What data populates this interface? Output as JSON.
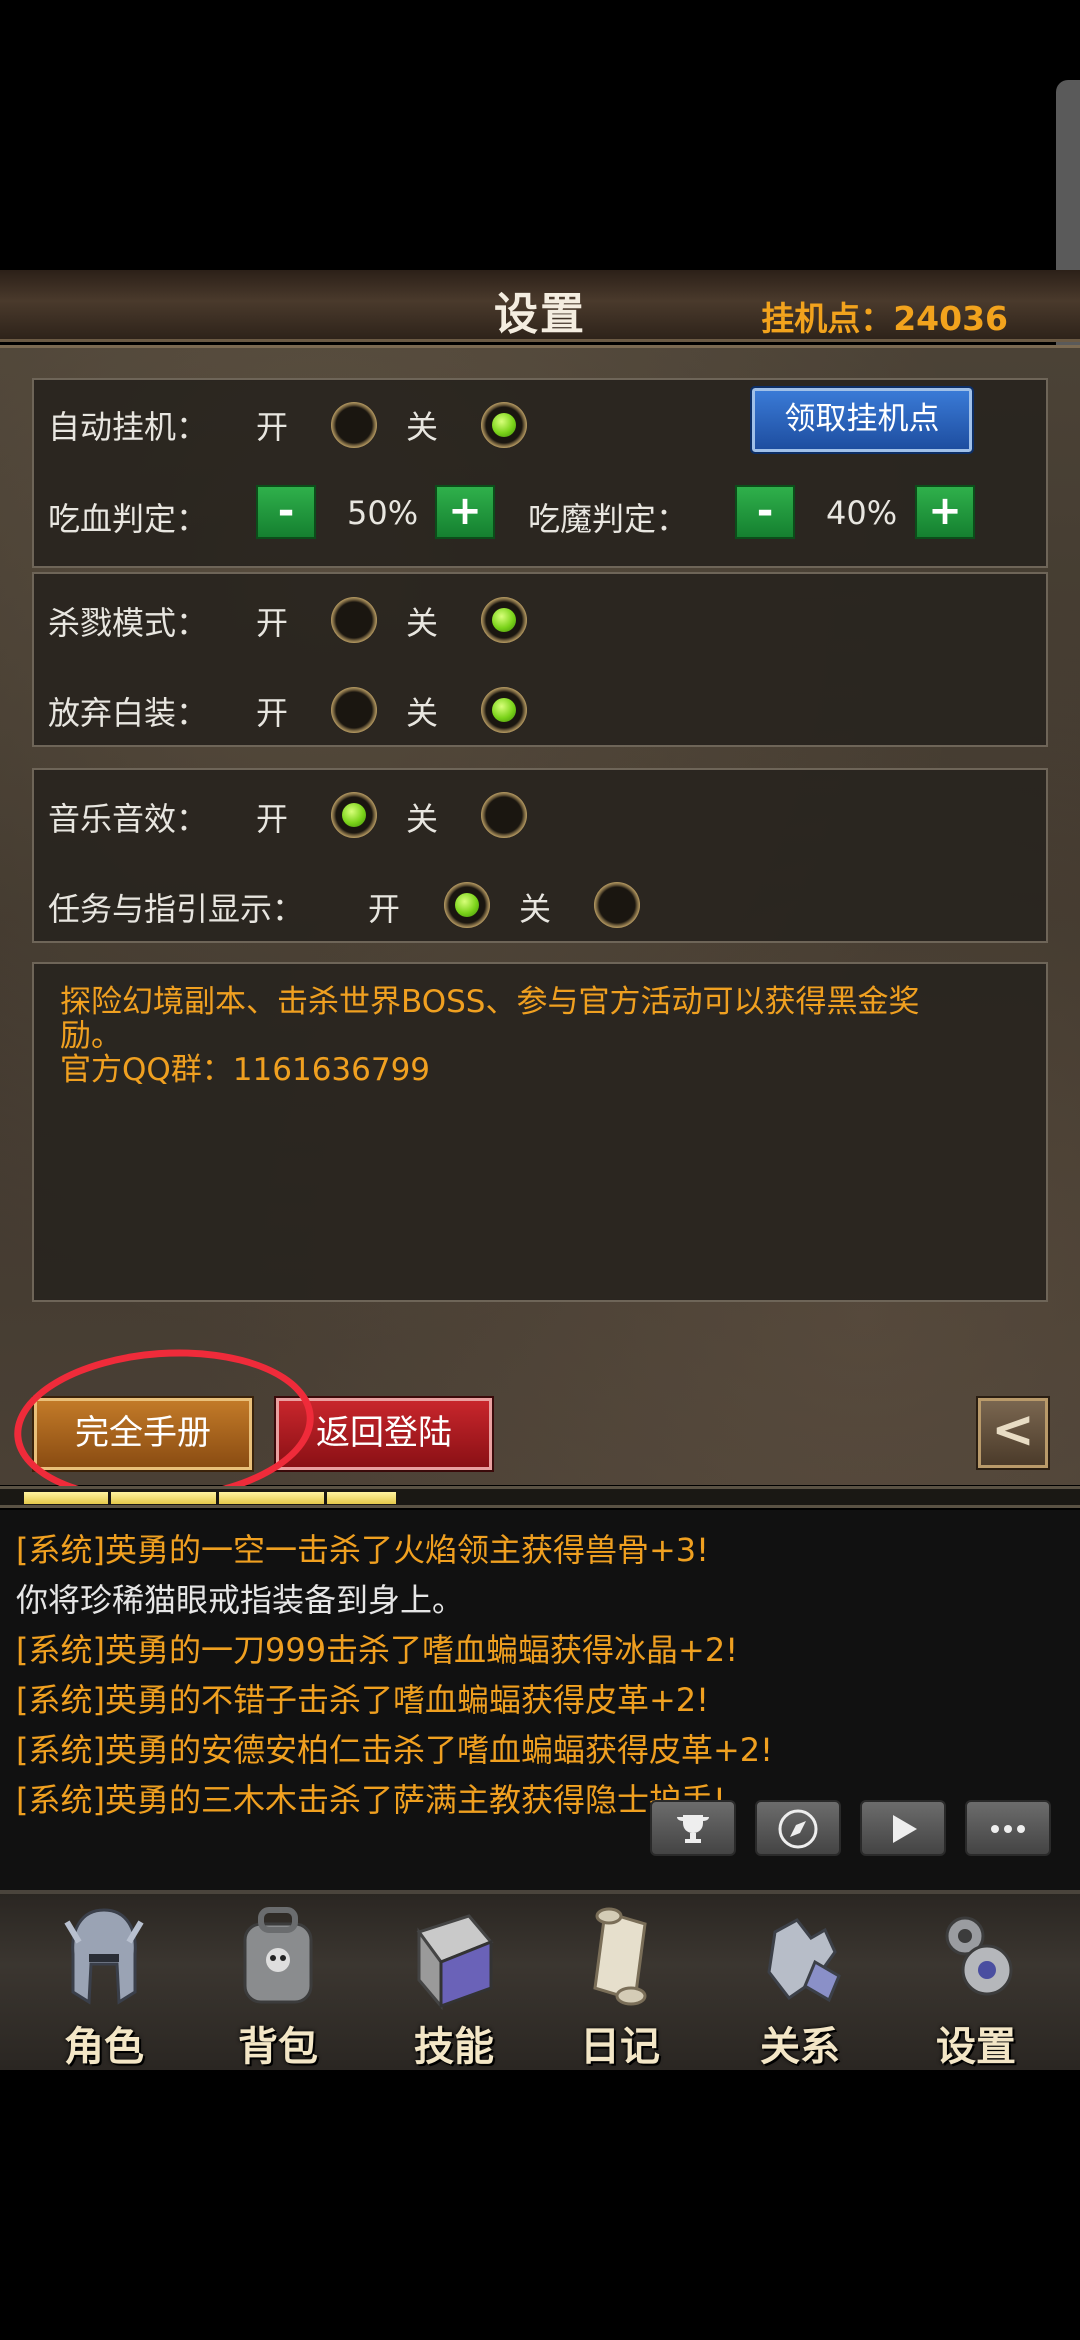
{
  "header": {
    "title": "设置",
    "afk_points": "挂机点：24036"
  },
  "auto_afk": {
    "label": "自动挂机：",
    "on": "开",
    "off": "关",
    "value": "off"
  },
  "claim_button": "领取挂机点",
  "hp_threshold": {
    "label": "吃血判定：",
    "value": "50%",
    "minus": "-",
    "plus": "+"
  },
  "mp_threshold": {
    "label": "吃魔判定：",
    "value": "40%",
    "minus": "-",
    "plus": "+"
  },
  "kill_mode": {
    "label": "杀戮模式：",
    "on": "开",
    "off": "关",
    "value": "off"
  },
  "discard_white": {
    "label": "放弃白装：",
    "on": "开",
    "off": "关",
    "value": "off"
  },
  "music_sfx": {
    "label": "音乐音效：",
    "on": "开",
    "off": "关",
    "value": "on"
  },
  "quest_guide": {
    "label": "任务与指引显示：",
    "on": "开",
    "off": "关",
    "value": "on"
  },
  "notice": {
    "line1": "探险幻境副本、击杀世界BOSS、参与官方活动可以获得黑金奖",
    "line2": "励。",
    "line3": "官方QQ群：1161636799"
  },
  "buttons": {
    "manual": "完全手册",
    "logout": "返回登陆",
    "back": "<"
  },
  "xp_progress": 0.36,
  "chat": [
    {
      "text": "[系统]英勇的一空一击杀了火焰领主获得兽骨+3!",
      "type": "sys"
    },
    {
      "text": "你将珍稀猫眼戒指装备到身上。",
      "type": "normal"
    },
    {
      "text": "[系统]英勇的一刀999击杀了嗜血蝙蝠获得冰晶+2!",
      "type": "sys"
    },
    {
      "text": "[系统]英勇的不错子击杀了嗜血蝙蝠获得皮革+2!",
      "type": "sys"
    },
    {
      "text": "[系统]英勇的安德安柏仁击杀了嗜血蝙蝠获得皮革+2!",
      "type": "sys"
    },
    {
      "text": "[系统]英勇的三木木击杀了萨满主教获得隐士护手!",
      "type": "sys"
    }
  ],
  "chat_icons": [
    "trophy-icon",
    "compass-icon",
    "play-icon",
    "chat-bubble-icon"
  ],
  "nav": [
    {
      "label": "角色",
      "icon": "helmet-icon"
    },
    {
      "label": "背包",
      "icon": "backpack-icon"
    },
    {
      "label": "技能",
      "icon": "skill-book-icon"
    },
    {
      "label": "日记",
      "icon": "scroll-icon"
    },
    {
      "label": "关系",
      "icon": "gauntlet-icon"
    },
    {
      "label": "设置",
      "icon": "gear-icon"
    }
  ],
  "colors": {
    "accent_orange": "#f0a020",
    "radio_on": "#7bd31a",
    "highlight_red": "#ef2b3a"
  }
}
